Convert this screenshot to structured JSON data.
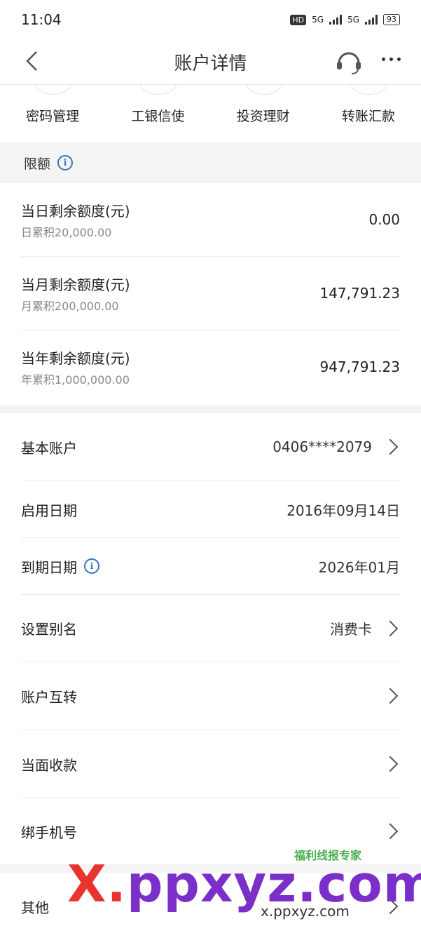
{
  "status": {
    "time": "11:04",
    "hd": "HD",
    "net1": "5G",
    "net2": "5G",
    "battery": "93"
  },
  "nav": {
    "title": "账户详情"
  },
  "quick": [
    "密码管理",
    "工银信使",
    "投资理财",
    "转账汇款"
  ],
  "limit": {
    "heading": "限额",
    "rows": [
      {
        "title": "当日剩余额度(元)",
        "sub": "日累积20,000.00",
        "value": "0.00"
      },
      {
        "title": "当月剩余额度(元)",
        "sub": "月累积200,000.00",
        "value": "147,791.23"
      },
      {
        "title": "当年剩余额度(元)",
        "sub": "年累积1,000,000.00",
        "value": "947,791.23"
      }
    ]
  },
  "details": [
    {
      "label": "基本账户",
      "value": "0406****2079"
    },
    {
      "label": "启用日期",
      "value": "2016年09月14日"
    },
    {
      "label": "到期日期",
      "value": "2026年01月"
    },
    {
      "label": "设置别名",
      "value": "消费卡"
    },
    {
      "label": "账户互转",
      "value": ""
    },
    {
      "label": "当面收款",
      "value": ""
    },
    {
      "label": "绑手机号",
      "value": ""
    }
  ],
  "other": {
    "label": "其他"
  },
  "watermark": {
    "brand_x": "X.",
    "brand_rest": "ppxyz.com",
    "sub": "x.ppxyz.com",
    "tag": "福利线报专家"
  }
}
